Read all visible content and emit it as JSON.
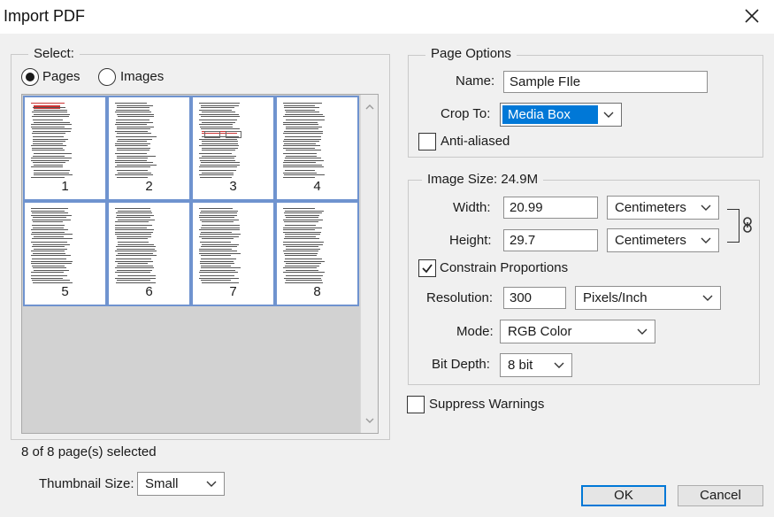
{
  "window": {
    "title": "Import PDF"
  },
  "select_group": {
    "legend": "Select:",
    "radio_pages": "Pages",
    "radio_images": "Images",
    "selected_mode": "Pages",
    "thumbnails": [
      "1",
      "2",
      "3",
      "4",
      "5",
      "6",
      "7",
      "8"
    ],
    "status": "8 of 8 page(s) selected",
    "thumbnail_size_label": "Thumbnail Size:",
    "thumbnail_size_value": "Small"
  },
  "page_options": {
    "legend": "Page Options",
    "name_label": "Name:",
    "name_value": "Sample FIle",
    "crop_label": "Crop To:",
    "crop_value": "Media Box",
    "anti_aliased_label": "Anti-aliased",
    "anti_aliased_checked": false
  },
  "image_size": {
    "legend": "Image Size: 24.9M",
    "width_label": "Width:",
    "width_value": "20.99",
    "width_unit": "Centimeters",
    "height_label": "Height:",
    "height_value": "29.7",
    "height_unit": "Centimeters",
    "constrain_label": "Constrain Proportions",
    "constrain_checked": true,
    "resolution_label": "Resolution:",
    "resolution_value": "300",
    "resolution_unit": "Pixels/Inch",
    "mode_label": "Mode:",
    "mode_value": "RGB Color",
    "bit_depth_label": "Bit Depth:",
    "bit_depth_value": "8 bit"
  },
  "suppress_warnings_label": "Suppress Warnings",
  "suppress_warnings_checked": false,
  "buttons": {
    "ok": "OK",
    "cancel": "Cancel"
  },
  "colors": {
    "accent": "#0078d7",
    "thumb_border": "#6f93cf",
    "dialog_bg": "#f0f0f0"
  },
  "icons": [
    "close-icon",
    "chevron-down-icon",
    "checkmark-icon",
    "link-icon",
    "scroll-up-icon",
    "scroll-down-icon"
  ]
}
